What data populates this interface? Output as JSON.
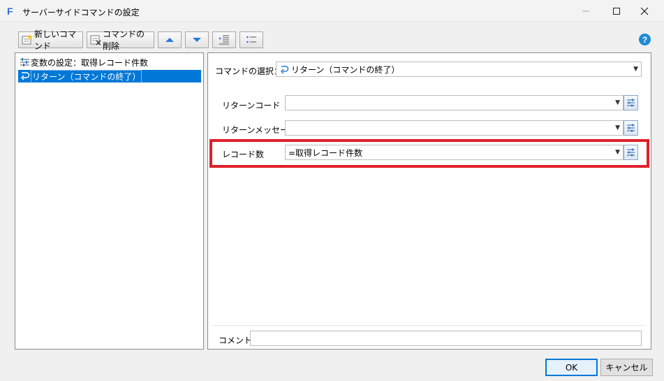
{
  "window": {
    "title": "サーバーサイドコマンドの設定",
    "app_icon_letter": "F"
  },
  "toolbar": {
    "new_command": "新しいコマンド",
    "delete_command": "コマンドの削除"
  },
  "tree": {
    "items": [
      {
        "label": "変数の設定：取得レコード件数",
        "icon": "variable-icon",
        "selected": false
      },
      {
        "label": "リターン（コマンドの終了）",
        "icon": "return-icon",
        "selected": true
      }
    ]
  },
  "form": {
    "command_select_label": "コマンドの選択：",
    "command_select_value": "リターン（コマンドの終了）",
    "return_code_label": "リターンコード",
    "return_code_value": "",
    "return_message_label": "リターンメッセージ",
    "return_message_value": "",
    "record_count_label": "レコード数",
    "record_count_value": "=取得レコード件数",
    "comment_label": "コメント",
    "comment_value": ""
  },
  "buttons": {
    "ok": "OK",
    "cancel": "キャンセル"
  },
  "colors": {
    "selection": "#0078d7",
    "highlight_border": "#e0202a",
    "help": "#1e8ad6"
  }
}
